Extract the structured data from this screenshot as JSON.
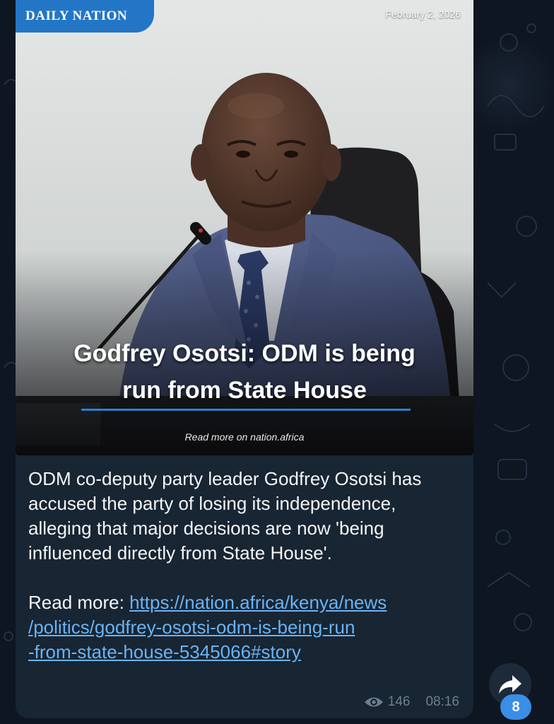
{
  "post": {
    "brand": "DAILY NATION",
    "article_date": "February 2, 2026",
    "headline_line1": "Godfrey Osotsi: ODM is being",
    "headline_line2": "run from State House",
    "source_credit": "Read more on nation.africa",
    "caption_p1": "ODM co-deputy party leader Godfrey Osotsi has accused the party of losing its independence, alleging that major decisions are now 'being influenced directly from State House'.",
    "read_more_label": "Read more: ",
    "link_line1": "https://nation.africa/kenya/news",
    "link_line2": "/politics/godfrey-osotsi-odm-is-being-run",
    "link_line3": "-from-state-house-5345066#story",
    "views": "146",
    "time": "08:16"
  },
  "badge_count": "8",
  "icons": {
    "views": "eye-icon",
    "forward": "forward-arrow-icon"
  },
  "colors": {
    "chat_background": "#0e1621",
    "bubble": "#182533",
    "brand_blue": "#2376c6",
    "link": "#6ab3f3",
    "meta": "#6d7f8f",
    "badge": "#3a8ee6"
  }
}
